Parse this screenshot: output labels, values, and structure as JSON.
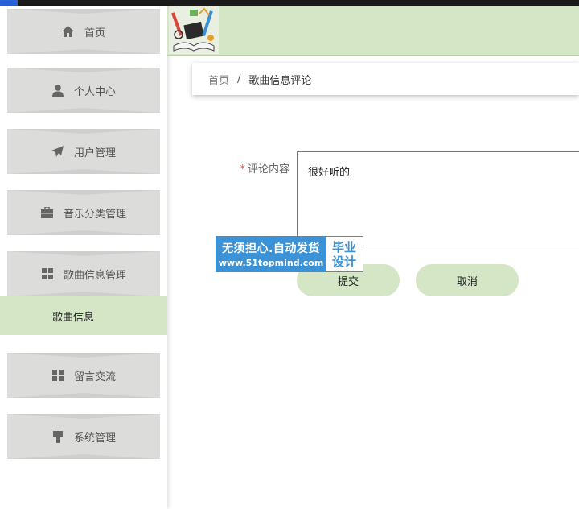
{
  "sidebar": {
    "items": [
      {
        "label": "首页",
        "icon": "home-icon"
      },
      {
        "label": "个人中心",
        "icon": "user-icon"
      },
      {
        "label": "用户管理",
        "icon": "paper-plane-icon"
      },
      {
        "label": "音乐分类管理",
        "icon": "briefcase-icon"
      },
      {
        "label": "歌曲信息管理",
        "icon": "grid-icon"
      },
      {
        "label": "留言交流",
        "icon": "grid-icon"
      },
      {
        "label": "系统管理",
        "icon": "brush-icon"
      }
    ],
    "active_submenu": "歌曲信息"
  },
  "breadcrumb": {
    "home": "首页",
    "separator": "/",
    "current": "歌曲信息评论"
  },
  "form": {
    "required_mark": "*",
    "content_label": "评论内容",
    "content_value": "很好听的",
    "submit_label": "提交",
    "cancel_label": "取消"
  },
  "watermark": {
    "line1": "无须担心.自动发货",
    "line2": "www.51topmind.com",
    "badge_line1": "毕业",
    "badge_line2": "设计"
  },
  "colors": {
    "accent": "#d4e6c6",
    "menu_bg": "#dcdcdb",
    "watermark_blue": "#3b92d6",
    "required": "#e0584e"
  }
}
